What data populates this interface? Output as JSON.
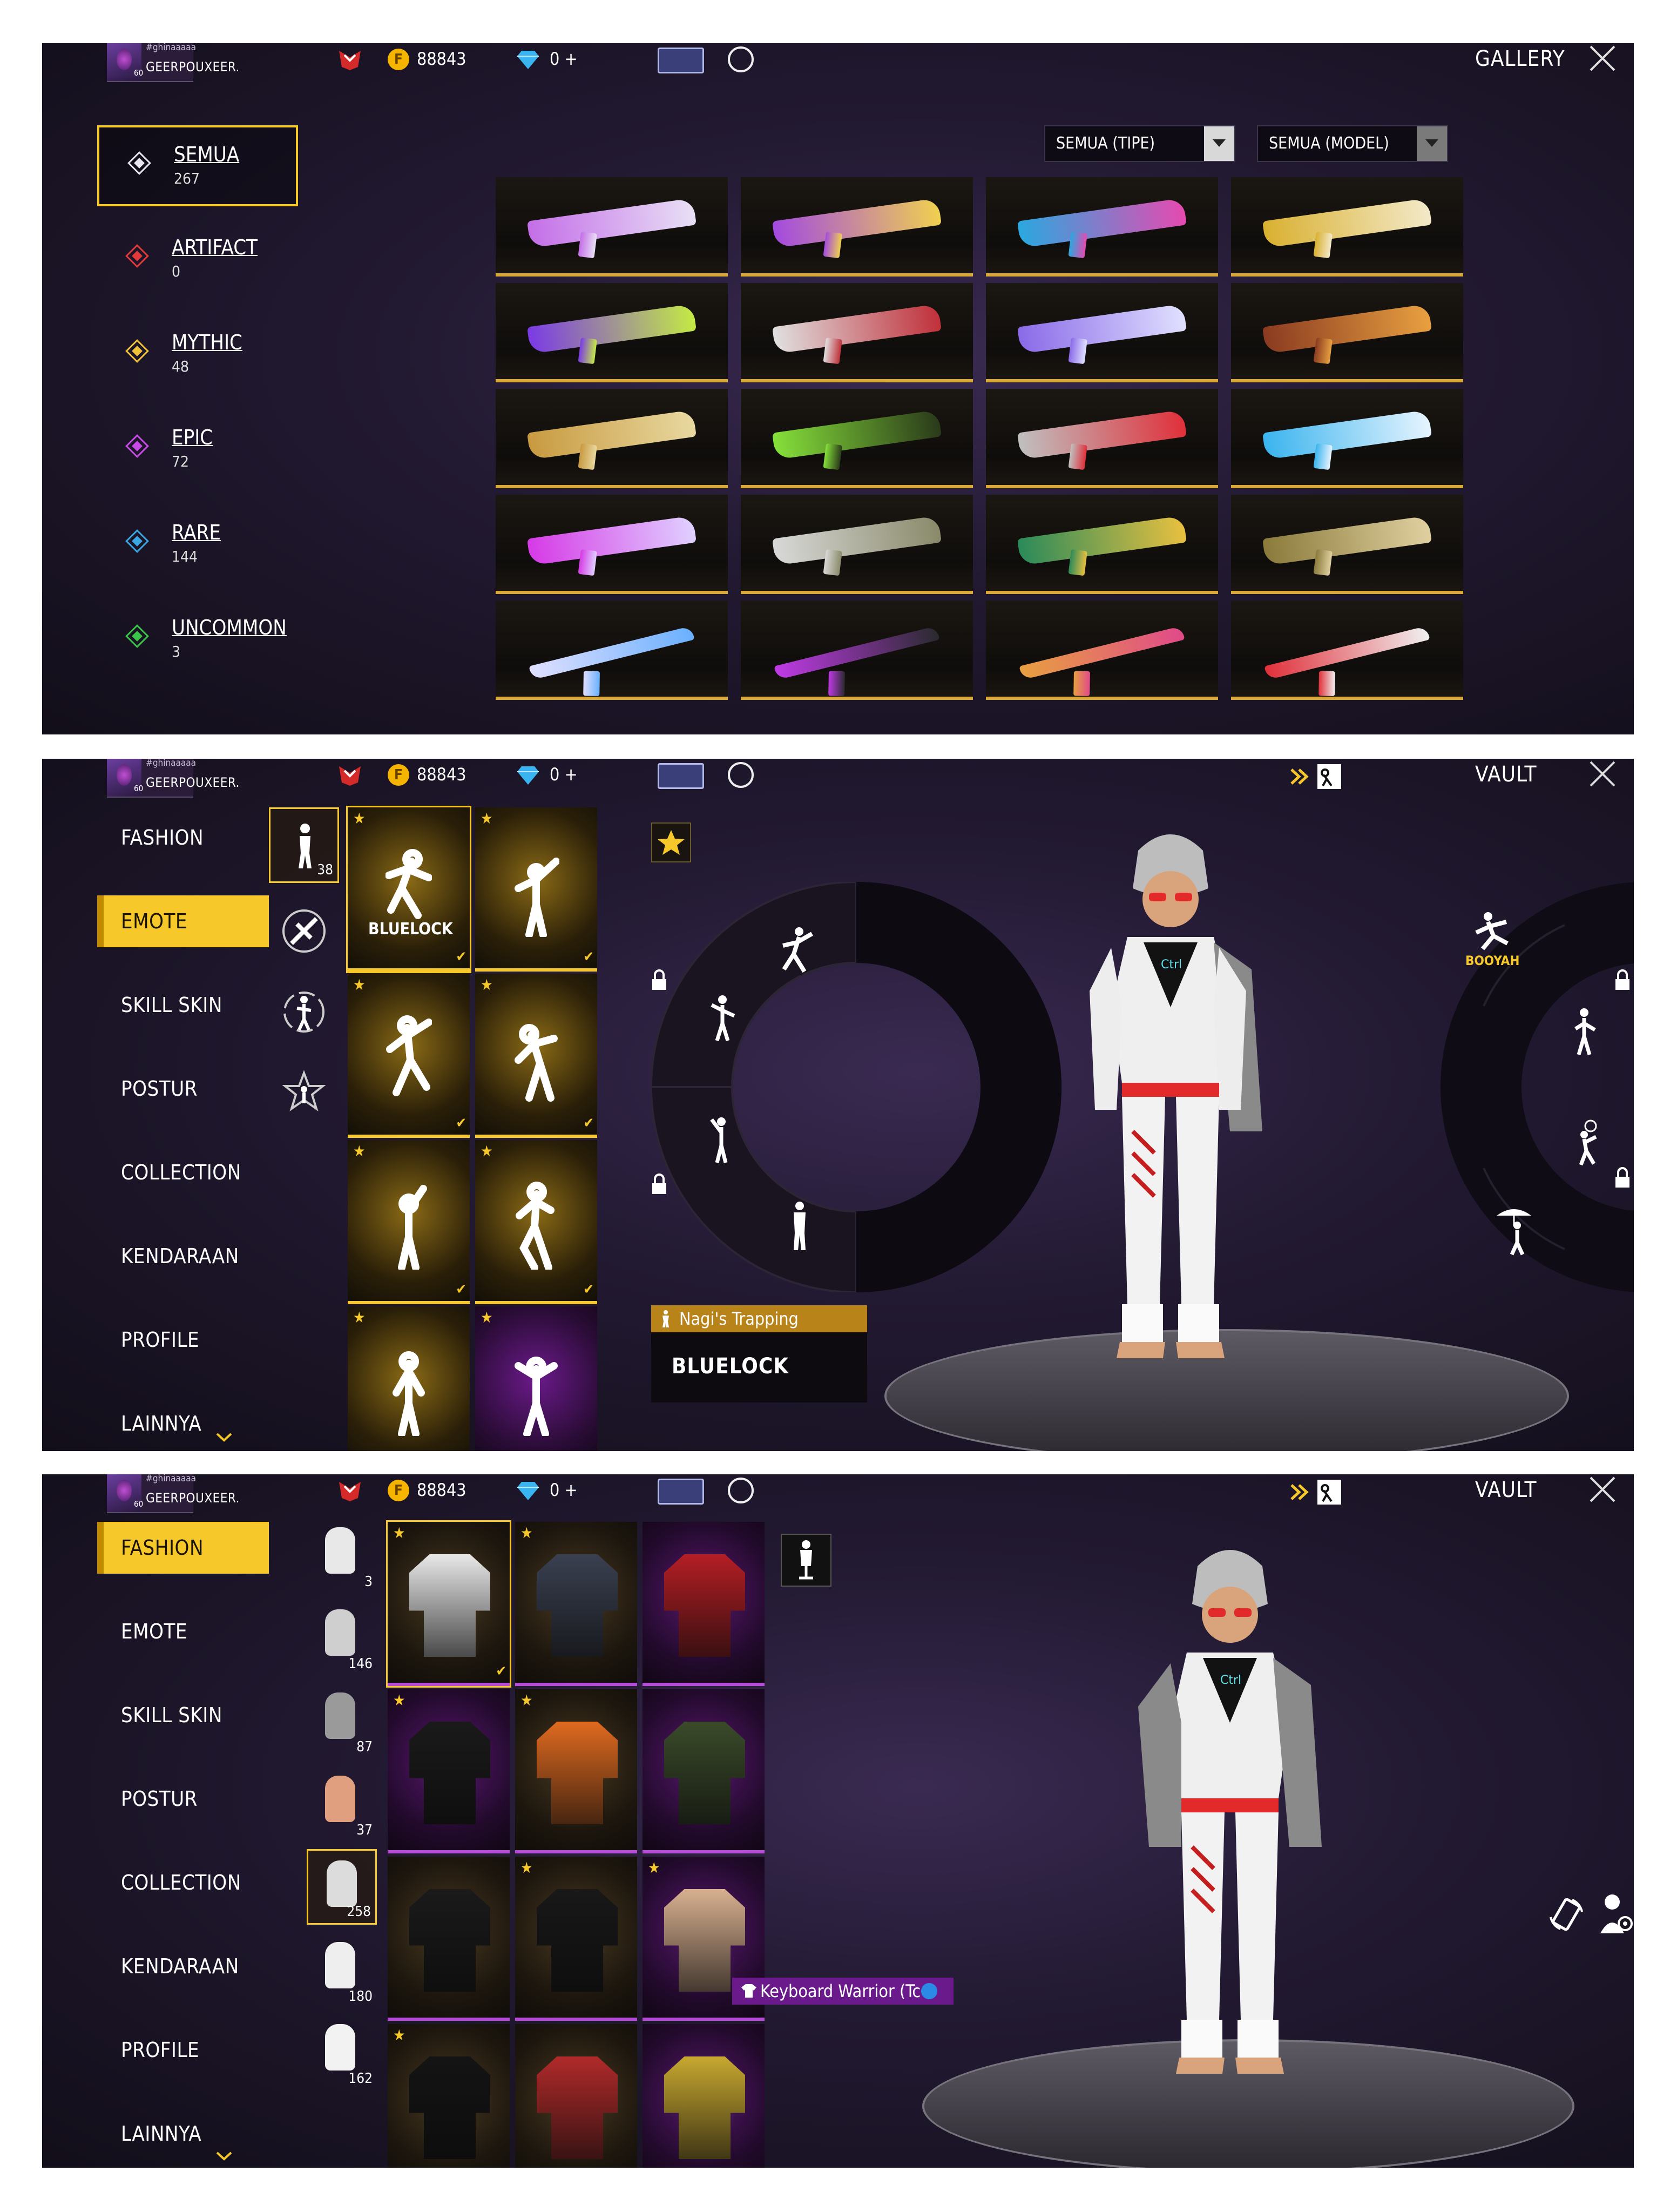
{
  "player": {
    "tag": "#ghinaaaaa",
    "name": "GEERPOUXEER.",
    "level": "60"
  },
  "currency": {
    "coin_symbol": "F",
    "coins": "88843",
    "diamonds": "0 +"
  },
  "gallery": {
    "title": "GALLERY",
    "filters": {
      "type": "SEMUA (TIPE)",
      "model": "SEMUA (MODEL)"
    },
    "categories": [
      {
        "label": "SEMUA",
        "count": "267",
        "color": "#e8e4f2"
      },
      {
        "label": "ARTIFACT",
        "count": "0",
        "color": "#e23a3a"
      },
      {
        "label": "MYTHIC",
        "count": "48",
        "color": "#f0c23a"
      },
      {
        "label": "EPIC",
        "count": "72",
        "color": "#c84ae6"
      },
      {
        "label": "RARE",
        "count": "144",
        "color": "#3aa6e2"
      },
      {
        "label": "UNCOMMON",
        "count": "3",
        "color": "#3ac44a"
      }
    ]
  },
  "vault": {
    "title": "VAULT",
    "menu": [
      "FASHION",
      "EMOTE",
      "SKILL SKIN",
      "POSTUR",
      "COLLECTION",
      "KENDARAAN",
      "PROFILE",
      "LAINNYA"
    ],
    "emote_tab_count": "38",
    "fashion_tab_counts": [
      "3",
      "146",
      "87",
      "37",
      "258",
      "180",
      "162"
    ],
    "emote_brand": "BLUELOCK",
    "wheel_booyah": "BOOYAH",
    "selected_emote": "Nagi's Trapping",
    "selected_emote_brand": "BLUELOCK",
    "selected_item": "Keyboard Warrior (Tc",
    "shirt_logo": "Ctrl"
  }
}
